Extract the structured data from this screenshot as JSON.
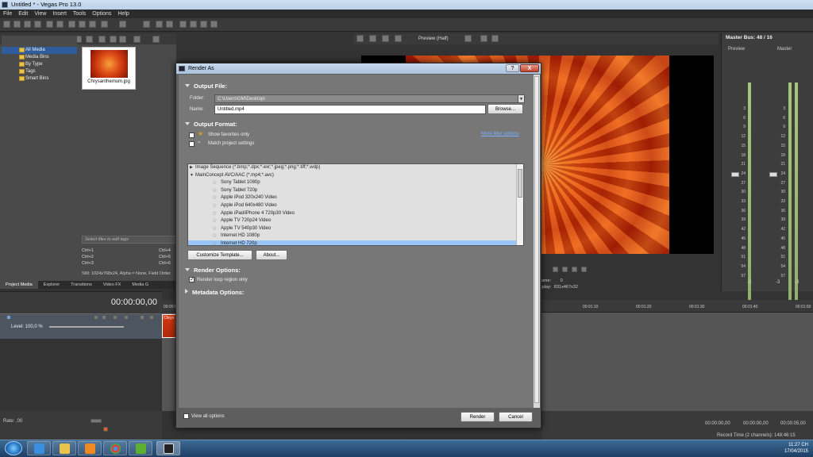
{
  "window": {
    "title": "Untitled * - Vegas Pro 13.0"
  },
  "menu": [
    "File",
    "Edit",
    "View",
    "Insert",
    "Tools",
    "Options",
    "Help"
  ],
  "media_tree": [
    {
      "label": "All Media",
      "selected": true
    },
    {
      "label": "Media Bins"
    },
    {
      "label": "By Type"
    },
    {
      "label": "Tags"
    },
    {
      "label": "Smart Bins"
    }
  ],
  "media_thumb": {
    "caption": "Chrysanthemum.jpg"
  },
  "tags_placeholder": "Select files to edit tags",
  "shortcuts": [
    {
      "key": "Ctrl+1",
      "key2": "Ctrl+4"
    },
    {
      "key": "Ctrl+2",
      "key2": "Ctrl+5"
    },
    {
      "key": "Ctrl+3",
      "key2": "Ctrl+6"
    }
  ],
  "still_info": "Still: 1024x768x24, Alpha = None, Field Order",
  "bottom_tabs": [
    "Project Media",
    "Explorer",
    "Transitions",
    "Video FX",
    "Media G"
  ],
  "preview": {
    "label": "Preview (Half)",
    "frame_label": "rame:",
    "frame_value": "0",
    "display_label": "splay:",
    "display_value": "831x467x32"
  },
  "master_bus": {
    "title": "Master Bus: 48 / 16",
    "preview": "Preview",
    "master": "Master",
    "scale": [
      "3",
      "6",
      "9",
      "12",
      "15",
      "18",
      "21",
      "24",
      "27",
      "30",
      "33",
      "36",
      "39",
      "42",
      "45",
      "48",
      "51",
      "54",
      "57"
    ],
    "bottom_left": "-3",
    "bottom_mid": "-3",
    "bottom_right": "-3"
  },
  "timeline": {
    "timecode": "00:00:00,00",
    "level": "Level: 100,0 %",
    "clip_label": "Chrys",
    "ruler": [
      "00:00:00,00",
      "00:01:10",
      "00:01:20",
      "00:01:30",
      "00:01:40",
      "00:01:50"
    ],
    "ruler_start": "00:00:00,00"
  },
  "lower": {
    "rate": "Rate: ,00",
    "tc1": "00:00:00,00",
    "tc2": "00:00:00,00",
    "tc3": "00:00:05,00",
    "record_time": "Record Time (2 channels): 148:46:15"
  },
  "tray": {
    "time": "11:27 CH",
    "date": "17/04/2015"
  },
  "dialog": {
    "title": "Render As",
    "help_label": "?",
    "close_label": "X",
    "output_file_header": "Output File:",
    "folder_label": "Folder:",
    "folder_value": "C:\\Users\\GM\\Desktop\\",
    "name_label": "Name:",
    "name_value": "Untitled.mp4",
    "browse_label": "Browse...",
    "output_format_header": "Output Format:",
    "show_favorites": "Show favorites only",
    "match_project": "Match project settings",
    "more_filter": "More filter options",
    "formats": [
      {
        "label": "Image Sequence (*.bmp;*.dpx;*.exr;*.jpeg;*.png;*.tiff;*.wdp)",
        "type": "group",
        "expanded": false
      },
      {
        "label": "MainConcept AVC/AAC (*.mp4;*.avc)",
        "type": "group",
        "expanded": true
      },
      {
        "label": "Sony Tablet 1080p",
        "type": "child"
      },
      {
        "label": "Sony Tablet 720p",
        "type": "child"
      },
      {
        "label": "Apple iPod 320x240 Video",
        "type": "child"
      },
      {
        "label": "Apple iPod 640x480 Video",
        "type": "child"
      },
      {
        "label": "Apple iPad/iPhone 4 720p30 Video",
        "type": "child"
      },
      {
        "label": "Apple TV 720p24 Video",
        "type": "child"
      },
      {
        "label": "Apple TV 540p30 Video",
        "type": "child"
      },
      {
        "label": "Internet HD 1080p",
        "type": "child"
      },
      {
        "label": "Internet HD 720p",
        "type": "child",
        "selected": true
      }
    ],
    "customize_label": "Customize Template...",
    "about_label": "About...",
    "render_options_header": "Render Options:",
    "render_loop": "Render loop region only",
    "metadata_header": "Metadata Options:",
    "view_all": "View all options",
    "render_label": "Render",
    "cancel_label": "Cancel"
  }
}
